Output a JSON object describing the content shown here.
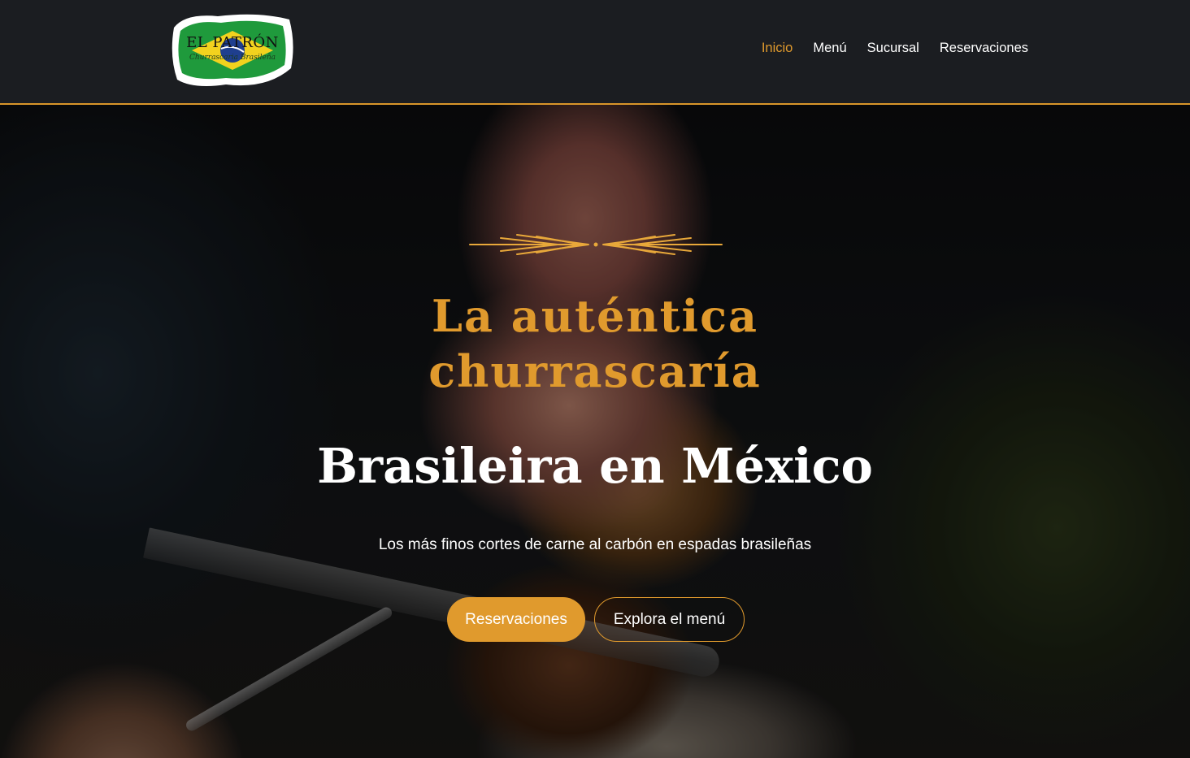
{
  "brand": {
    "name": "EL PATRÓN",
    "tagline": "Churrascaria Brasileña"
  },
  "nav": {
    "items": [
      {
        "label": "Inicio",
        "active": true
      },
      {
        "label": "Menú",
        "active": false
      },
      {
        "label": "Sucursal",
        "active": false
      },
      {
        "label": "Reservaciones",
        "active": false
      }
    ]
  },
  "hero": {
    "title_line1": "La auténtica",
    "title_line2": "churrascaría",
    "title_line3": "Brasileira en México",
    "subtitle": "Los más finos cortes de carne al carbón en espadas brasileñas",
    "primary_button": "Reservaciones",
    "secondary_button": "Explora el menú"
  },
  "colors": {
    "accent": "#e09a2d",
    "header_bg": "#1b1d21",
    "text_light": "#ffffff"
  },
  "icons": {
    "ornament": "wheat-arrows-divider-icon",
    "logo": "brazil-flag-logo"
  }
}
